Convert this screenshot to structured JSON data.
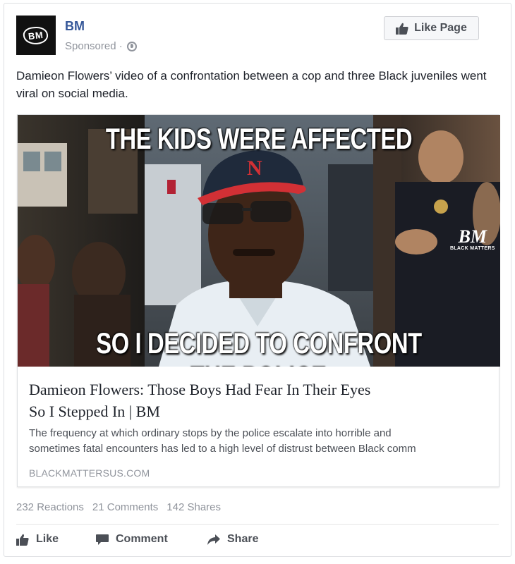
{
  "post": {
    "page_name": "BM",
    "avatar_text": "BM",
    "sponsored_label": "Sponsored ·",
    "like_page_label": "Like Page",
    "text": "Damieon Flowers’ video of a confrontation between a cop and three Black juveniles went viral on social media."
  },
  "link_card": {
    "image_top_text": "THE KIDS WERE AFFECTED",
    "image_bottom_text": "SO I DECIDED TO CONFRONT THE POLICE",
    "watermark_big": "BM",
    "watermark_small": "BLACK MATTERS",
    "title_line1": "Damieon Flowers: Those Boys Had Fear In Their Eyes",
    "title_line2": "So I Stepped In | BM",
    "description_line1": "The frequency at which ordinary stops by the police escalate into horrible and",
    "description_line2": "sometimes fatal encounters has led to a high level of distrust between Black comm",
    "domain": "BLACKMATTERSUS.COM"
  },
  "stats": {
    "reactions": "232 Reactions",
    "comments": "21 Comments",
    "shares": "142 Shares"
  },
  "actions": {
    "like": "Like",
    "comment": "Comment",
    "share": "Share"
  },
  "colors": {
    "link_blue": "#365899",
    "meta_gray": "#90949c",
    "action_gray": "#4b4f56"
  },
  "icons": [
    "globe-icon",
    "thumbs-up-icon",
    "comment-icon",
    "share-icon"
  ]
}
